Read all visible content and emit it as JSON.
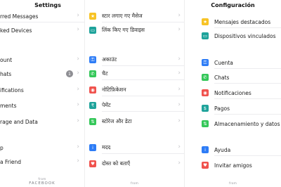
{
  "english": {
    "title": "Settings",
    "rows": [
      {
        "label": "rred Messages"
      },
      {
        "label": "ked Devices"
      },
      {
        "label": "ount"
      },
      {
        "label": "hats",
        "badge": "1"
      },
      {
        "label": "ifications"
      },
      {
        "label": "ments"
      },
      {
        "label": "rage and Data"
      },
      {
        "label": "p"
      },
      {
        "label": "a Friend"
      }
    ],
    "footer_from": "from",
    "footer_brand": "FACEBOOK"
  },
  "hindi": {
    "rows": [
      {
        "label": "स्टार लगाए गए मैसेज",
        "icon": "star-icon",
        "color": "#f7c325",
        "glyph": "★"
      },
      {
        "label": "लिंक किए गए डिवाइस",
        "icon": "laptop-icon",
        "color": "#1fa39b",
        "glyph": "▭"
      },
      {
        "label": "अकाउंट",
        "icon": "key-icon",
        "color": "#2d7cf6",
        "glyph": "⚿"
      },
      {
        "label": "चैट",
        "icon": "whatsapp-icon",
        "color": "#34c759",
        "glyph": "✆"
      },
      {
        "label": "नोटिफ़िकेशन",
        "icon": "notification-icon",
        "color": "#f0524d",
        "glyph": "◉"
      },
      {
        "label": "पेमेंट",
        "icon": "payment-icon",
        "color": "#1fa39b",
        "glyph": "₹"
      },
      {
        "label": "स्टोरेज और डेटा",
        "icon": "storage-icon",
        "color": "#34c759",
        "glyph": "⇅"
      },
      {
        "label": "मदद",
        "icon": "help-icon",
        "color": "#2d7cf6",
        "glyph": "i"
      },
      {
        "label": "दोस्त को बताएँ",
        "icon": "heart-icon",
        "color": "#f0524d",
        "glyph": "♥"
      }
    ],
    "badge": "1",
    "footer_from": "from"
  },
  "spanish": {
    "title": "Configuración",
    "rows": [
      {
        "label": "Mensajes destacados",
        "icon": "star-icon",
        "color": "#f7c325",
        "glyph": "★"
      },
      {
        "label": "Dispositivos vinculados",
        "icon": "laptop-icon",
        "color": "#1fa39b",
        "glyph": "▭"
      },
      {
        "label": "Cuenta",
        "icon": "key-icon",
        "color": "#2d7cf6",
        "glyph": "⚿"
      },
      {
        "label": "Chats",
        "icon": "whatsapp-icon",
        "color": "#34c759",
        "glyph": "✆"
      },
      {
        "label": "Notificaciones",
        "icon": "notification-icon",
        "color": "#f0524d",
        "glyph": "◉"
      },
      {
        "label": "Pagos",
        "icon": "payment-icon",
        "color": "#1fa39b",
        "glyph": "$"
      },
      {
        "label": "Almacenamiento y datos",
        "icon": "storage-icon",
        "color": "#34c759",
        "glyph": "⇅"
      },
      {
        "label": "Ayuda",
        "icon": "help-icon",
        "color": "#2d7cf6",
        "glyph": "i"
      },
      {
        "label": "Invitar amigos",
        "icon": "heart-icon",
        "color": "#f0524d",
        "glyph": "♥"
      }
    ],
    "footer_from": "from"
  }
}
